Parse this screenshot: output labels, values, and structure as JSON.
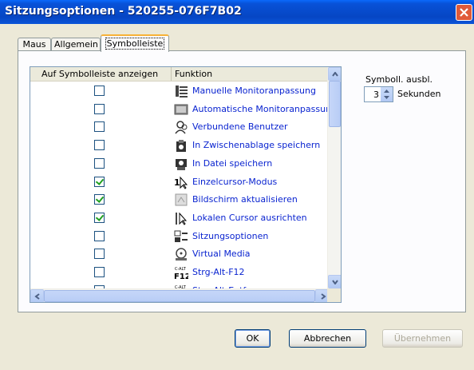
{
  "window": {
    "title": "Sitzungsoptionen - 520255-076F7B02"
  },
  "tabs": [
    {
      "label": "Maus"
    },
    {
      "label": "Allgemein"
    },
    {
      "label": "Symbolleiste"
    }
  ],
  "list": {
    "columns": {
      "show": "Auf Symbolleiste anzeigen",
      "function": "Funktion"
    },
    "rows": [
      {
        "label": "Manuelle Monitoranpassung",
        "checked": false,
        "icon": "monitor-adjust-icon"
      },
      {
        "label": "Automatische Monitoranpassung",
        "checked": false,
        "icon": "auto-monitor-icon"
      },
      {
        "label": "Verbundene Benutzer",
        "checked": false,
        "icon": "users-icon"
      },
      {
        "label": "In Zwischenablage speichern",
        "checked": false,
        "icon": "clipboard-camera-icon"
      },
      {
        "label": "In Datei speichern",
        "checked": false,
        "icon": "save-file-icon"
      },
      {
        "label": "Einzelcursor-Modus",
        "checked": true,
        "icon": "single-cursor-icon"
      },
      {
        "label": "Bildschirm aktualisieren",
        "checked": true,
        "icon": "refresh-screen-icon"
      },
      {
        "label": "Lokalen Cursor ausrichten",
        "checked": true,
        "icon": "align-cursor-icon"
      },
      {
        "label": "Sitzungsoptionen",
        "checked": false,
        "icon": "session-options-icon"
      },
      {
        "label": "Virtual Media",
        "checked": false,
        "icon": "virtual-media-icon"
      },
      {
        "label": "Strg-Alt-F12",
        "checked": false,
        "icon": "ctrl-alt-f12-icon",
        "icon_text": "C-ALT F12"
      },
      {
        "label": "Strg-Alt-Entf",
        "checked": false,
        "icon": "ctrl-alt-del-icon",
        "icon_text": "C-ALT"
      }
    ]
  },
  "hide_after": {
    "label": "Symboll. ausbl.",
    "value": "3",
    "unit": "Sekunden"
  },
  "buttons": {
    "ok": "OK",
    "cancel": "Abbrechen",
    "apply": "Übernehmen"
  }
}
